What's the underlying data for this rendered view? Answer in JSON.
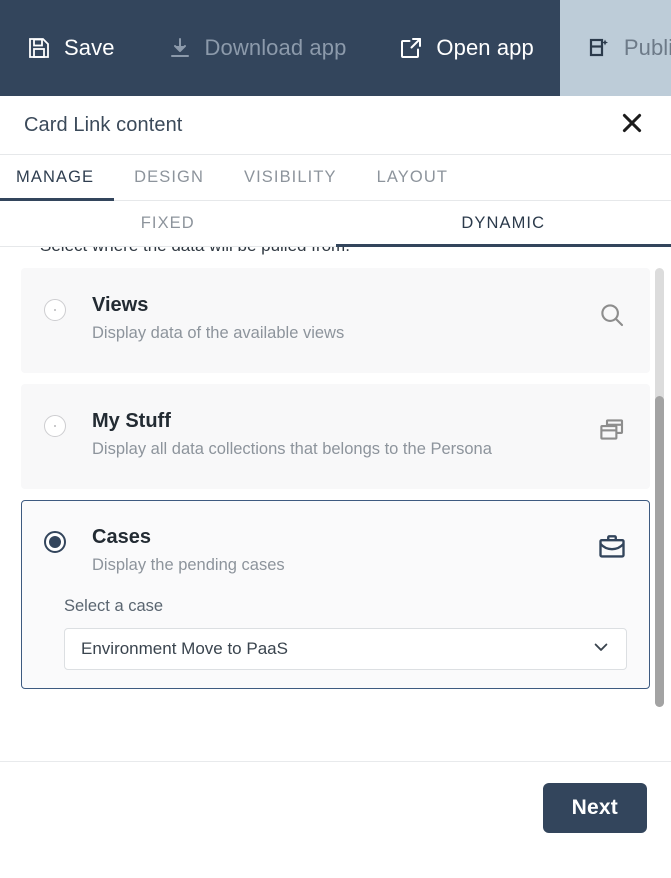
{
  "toolbar": {
    "items": [
      {
        "label": "Save",
        "icon": "save-icon",
        "state": "enabled"
      },
      {
        "label": "Download app",
        "icon": "download-icon",
        "state": "disabled"
      },
      {
        "label": "Open app",
        "icon": "external-link-icon",
        "state": "enabled"
      },
      {
        "label": "Publish",
        "icon": "publish-icon",
        "state": "highlighted"
      }
    ],
    "background": "#33455c",
    "publish_background": "#bdccd8"
  },
  "panel": {
    "title": "Card Link content",
    "close_icon": "close-icon"
  },
  "tabs": [
    {
      "label": "MANAGE",
      "active": true
    },
    {
      "label": "DESIGN",
      "active": false
    },
    {
      "label": "VISIBILITY",
      "active": false
    },
    {
      "label": "LAYOUT",
      "active": false
    }
  ],
  "subtabs": [
    {
      "label": "FIXED",
      "active": false
    },
    {
      "label": "DYNAMIC",
      "active": true
    }
  ],
  "body": {
    "hint": "Select where the data will be pulled from.",
    "options": [
      {
        "title": "Views",
        "subtitle": "Display data of the available views",
        "icon": "search-icon",
        "selected": false
      },
      {
        "title": "My Stuff",
        "subtitle": "Display all data collections that belongs to the Persona",
        "icon": "collections-icon",
        "selected": false
      },
      {
        "title": "Cases",
        "subtitle": "Display the pending cases",
        "icon": "briefcase-icon",
        "selected": true,
        "field": {
          "label": "Select a case",
          "value": "Environment Move to PaaS",
          "chevron_icon": "chevron-down-icon"
        }
      }
    ]
  },
  "footer": {
    "next_label": "Next"
  },
  "colors": {
    "accent": "#33455c",
    "selected_border": "#3d5a80",
    "muted_text": "#8d949c"
  }
}
